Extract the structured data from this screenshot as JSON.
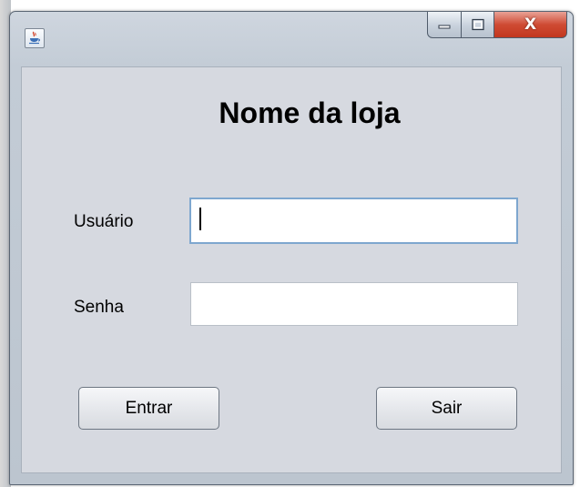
{
  "window": {
    "icon": "java-coffee-icon",
    "controls": {
      "minimize_icon": "minimize-icon",
      "maximize_icon": "maximize-icon",
      "close_icon": "close-icon",
      "close_glyph": "X"
    }
  },
  "form": {
    "title": "Nome da loja",
    "username_label": "Usuário",
    "username_value": "",
    "password_label": "Senha",
    "password_value": "",
    "enter_button": "Entrar",
    "exit_button": "Sair"
  },
  "colors": {
    "panel_bg": "#d6d9e0",
    "close_button": "#c2371f",
    "focus_border": "#7ea7cf"
  }
}
